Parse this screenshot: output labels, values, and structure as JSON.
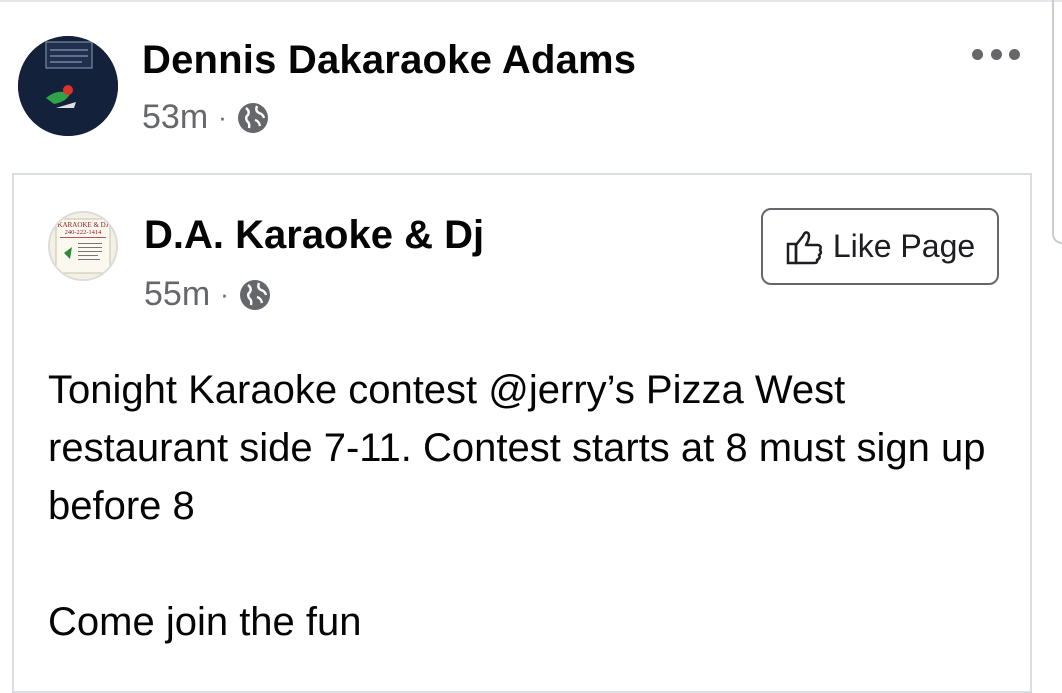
{
  "post": {
    "author": "Dennis Dakaraoke Adams",
    "time": "53m",
    "separator": "·",
    "privacy_icon": "globe-icon",
    "more_icon": "more-horizontal-icon"
  },
  "shared": {
    "page_name": "D.A. Karaoke & Dj",
    "time": "55m",
    "separator": "·",
    "privacy_icon": "globe-icon",
    "like_label": "Like Page",
    "like_icon": "thumbs-up-icon",
    "avatar_text_top": "KARAOKE & DJ",
    "avatar_text_phone": "240-222-1414",
    "text": "Tonight Karaoke contest @jerry’s Pizza West restaurant side 7-11. Contest starts at 8 must sign up before 8\n\nCome join the fun"
  },
  "colors": {
    "meta_gray": "#65676b",
    "border": "#dadde1"
  }
}
